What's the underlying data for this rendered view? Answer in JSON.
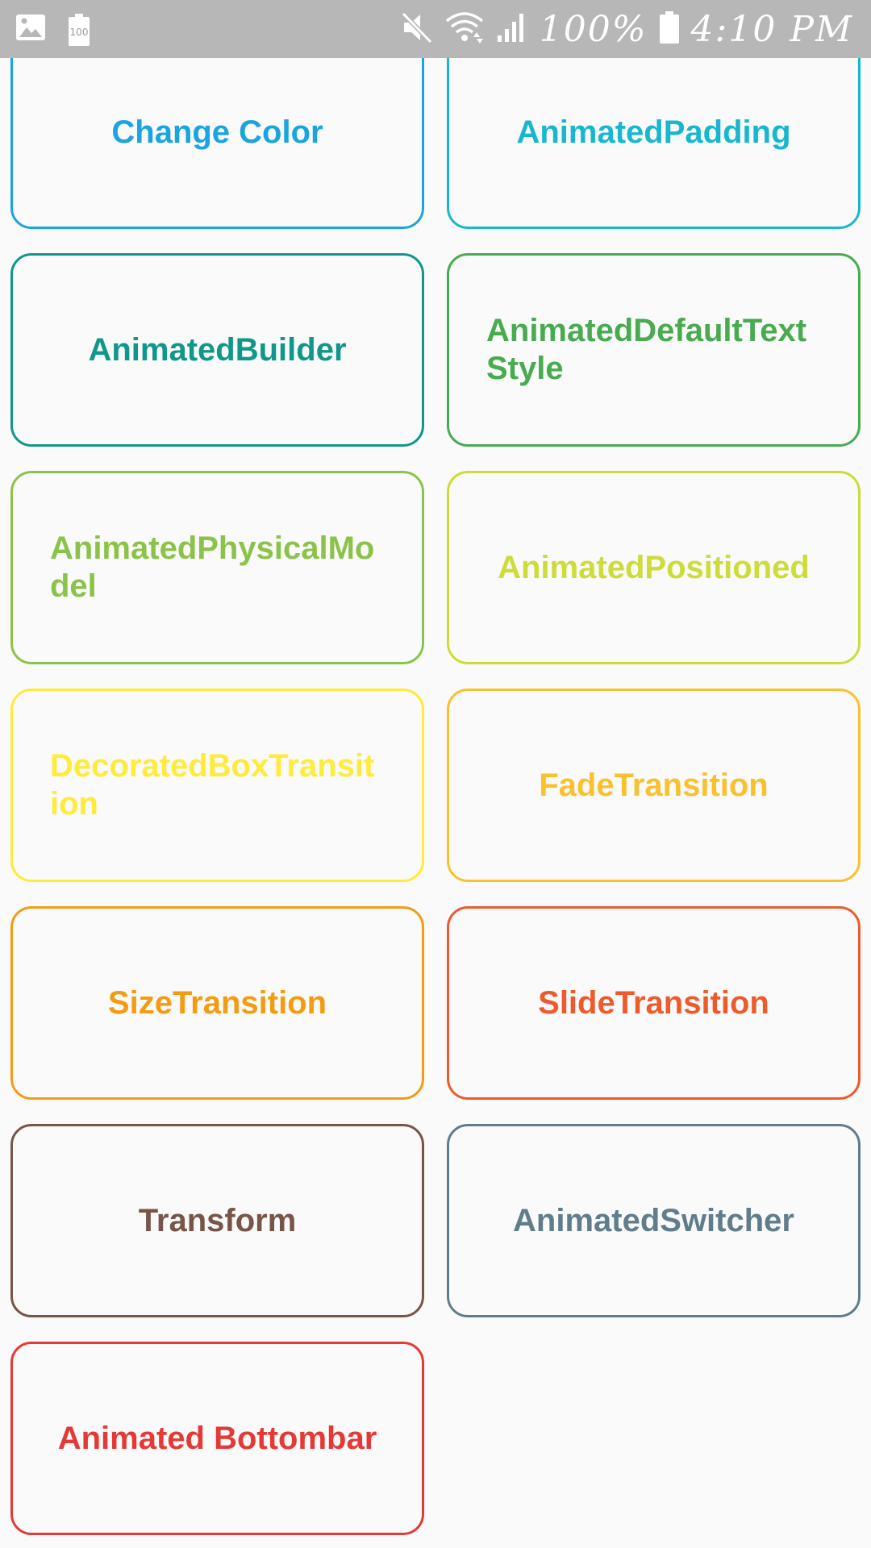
{
  "status_bar": {
    "battery_percent_text": "100%",
    "time": "4:10 PM",
    "battery_icon_text": "100",
    "icons": [
      "image-icon",
      "battery-saver-icon",
      "mute-icon",
      "wifi-icon",
      "signal-icon",
      "battery-icon"
    ]
  },
  "cards": [
    {
      "label": "Change Color",
      "color": "#1ba4e0"
    },
    {
      "label": "AnimatedPadding",
      "color": "#19b7cf"
    },
    {
      "label": "AnimatedBuilder",
      "color": "#0f978a"
    },
    {
      "label": "AnimatedDefaultTextStyle",
      "color": "#48ab4f"
    },
    {
      "label": "AnimatedPhysicalModel",
      "color": "#8bc34a"
    },
    {
      "label": "AnimatedPositioned",
      "color": "#cddc39"
    },
    {
      "label": "DecoratedBoxTransition",
      "color": "#ffeb3b"
    },
    {
      "label": "FadeTransition",
      "color": "#fbc02d"
    },
    {
      "label": "SizeTransition",
      "color": "#f39c12"
    },
    {
      "label": "SlideTransition",
      "color": "#ee5a2c"
    },
    {
      "label": "Transform",
      "color": "#795548"
    },
    {
      "label": "AnimatedSwitcher",
      "color": "#607d8b"
    },
    {
      "label": "Animated Bottombar",
      "color": "#e53935"
    }
  ]
}
